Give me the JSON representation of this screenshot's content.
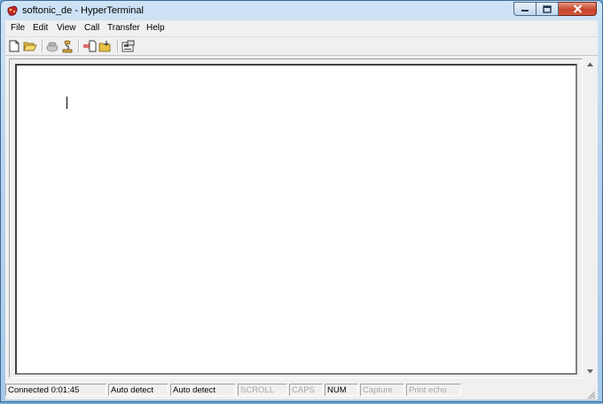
{
  "window": {
    "title": "softonic_de - HyperTerminal"
  },
  "menu": [
    {
      "label": "File"
    },
    {
      "label": "Edit"
    },
    {
      "label": "View"
    },
    {
      "label": "Call"
    },
    {
      "label": "Transfer"
    },
    {
      "label": "Help"
    }
  ],
  "toolbar": {
    "buttons": [
      "new-icon",
      "open-icon",
      "disconnect-icon",
      "connect-icon",
      "send-icon",
      "receive-icon",
      "properties-icon"
    ]
  },
  "status": {
    "connected": "Connected 0:01:45",
    "detect1": "Auto detect",
    "detect2": "Auto detect",
    "scroll": "SCROLL",
    "caps": "CAPS",
    "num": "NUM",
    "capture": "Capture",
    "print_echo": "Print echo"
  },
  "colors": {
    "close_button": "#c7442b",
    "frame": "#b9d4ee",
    "terminal_bg": "#ffffff"
  }
}
